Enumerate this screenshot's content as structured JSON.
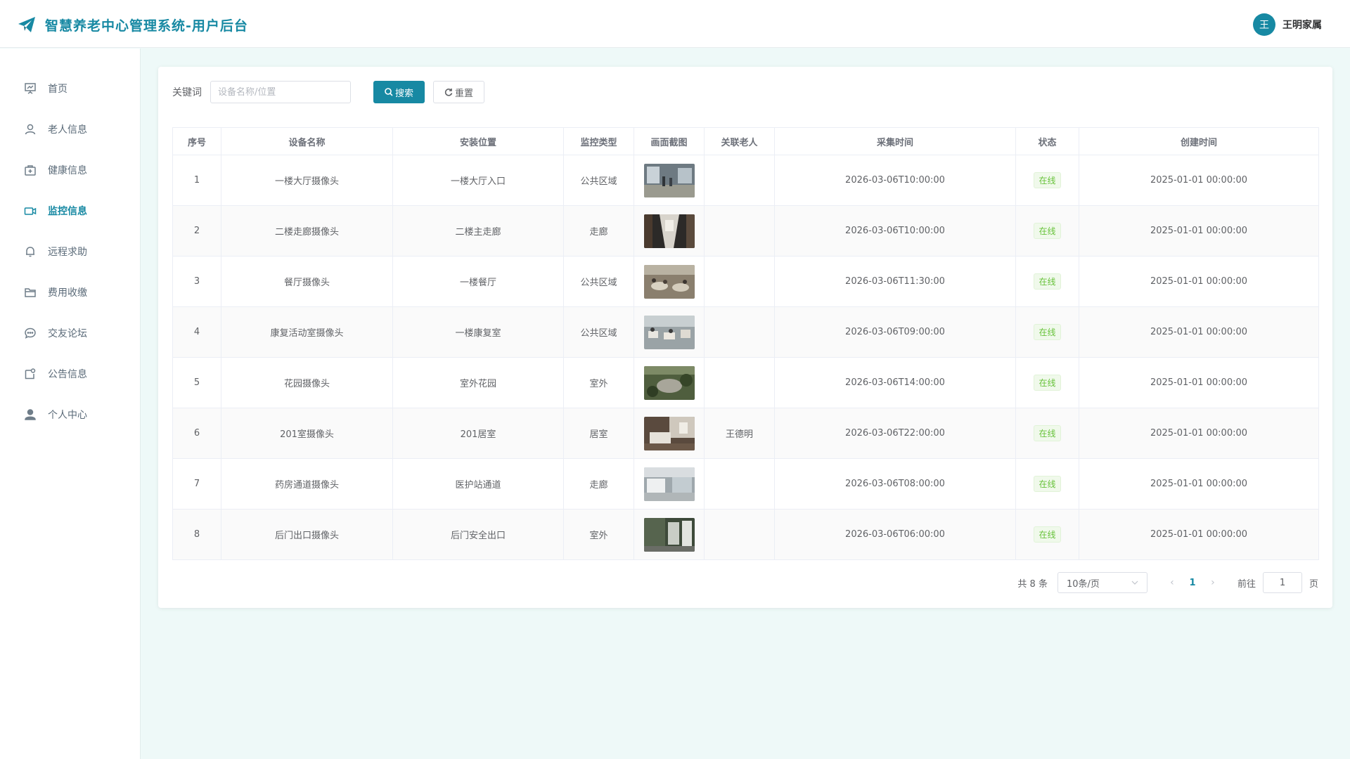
{
  "header": {
    "app_title": "智慧养老中心管理系统-用户后台",
    "user_avatar": "王",
    "user_name": "王明家属",
    "brand_color": "#1789a3"
  },
  "sidebar": {
    "items": [
      {
        "label": "首页",
        "icon": "presentation-icon",
        "active": false
      },
      {
        "label": "老人信息",
        "icon": "user-icon",
        "active": false
      },
      {
        "label": "健康信息",
        "icon": "medical-kit-icon",
        "active": false
      },
      {
        "label": "监控信息",
        "icon": "camera-icon",
        "active": true
      },
      {
        "label": "远程求助",
        "icon": "bell-icon",
        "active": false
      },
      {
        "label": "费用收缴",
        "icon": "folder-icon",
        "active": false
      },
      {
        "label": "交友论坛",
        "icon": "chat-icon",
        "active": false
      },
      {
        "label": "公告信息",
        "icon": "notice-icon",
        "active": false
      },
      {
        "label": "个人中心",
        "icon": "person-icon",
        "active": false
      }
    ]
  },
  "search": {
    "keyword_label": "关键词",
    "placeholder": "设备名称/位置",
    "value": "",
    "search_label": "搜索",
    "reset_label": "重置"
  },
  "table": {
    "columns": [
      "序号",
      "设备名称",
      "安装位置",
      "监控类型",
      "画面截图",
      "关联老人",
      "采集时间",
      "状态",
      "创建时间"
    ],
    "rows": [
      {
        "index": "1",
        "name": "一楼大厅摄像头",
        "location": "一楼大厅入口",
        "type": "公共区域",
        "screenshot": "lobby",
        "elder": "",
        "capture_time": "2026-03-06T10:00:00",
        "status": "在线",
        "created": "2025-01-01 00:00:00"
      },
      {
        "index": "2",
        "name": "二楼走廊摄像头",
        "location": "二楼主走廊",
        "type": "走廊",
        "screenshot": "corridor",
        "elder": "",
        "capture_time": "2026-03-06T10:00:00",
        "status": "在线",
        "created": "2025-01-01 00:00:00"
      },
      {
        "index": "3",
        "name": "餐厅摄像头",
        "location": "一楼餐厅",
        "type": "公共区域",
        "screenshot": "dining",
        "elder": "",
        "capture_time": "2026-03-06T11:30:00",
        "status": "在线",
        "created": "2025-01-01 00:00:00"
      },
      {
        "index": "4",
        "name": "康复活动室摄像头",
        "location": "一楼康复室",
        "type": "公共区域",
        "screenshot": "rehab",
        "elder": "",
        "capture_time": "2026-03-06T09:00:00",
        "status": "在线",
        "created": "2025-01-01 00:00:00"
      },
      {
        "index": "5",
        "name": "花园摄像头",
        "location": "室外花园",
        "type": "室外",
        "screenshot": "garden",
        "elder": "",
        "capture_time": "2026-03-06T14:00:00",
        "status": "在线",
        "created": "2025-01-01 00:00:00"
      },
      {
        "index": "6",
        "name": "201室摄像头",
        "location": "201居室",
        "type": "居室",
        "screenshot": "room",
        "elder": "王德明",
        "capture_time": "2026-03-06T22:00:00",
        "status": "在线",
        "created": "2025-01-01 00:00:00"
      },
      {
        "index": "7",
        "name": "药房通道摄像头",
        "location": "医护站通道",
        "type": "走廊",
        "screenshot": "pharmacy",
        "elder": "",
        "capture_time": "2026-03-06T08:00:00",
        "status": "在线",
        "created": "2025-01-01 00:00:00"
      },
      {
        "index": "8",
        "name": "后门出口摄像头",
        "location": "后门安全出口",
        "type": "室外",
        "screenshot": "backdoor",
        "elder": "",
        "capture_time": "2026-03-06T06:00:00",
        "status": "在线",
        "created": "2025-01-01 00:00:00"
      }
    ],
    "status_color": "#67c23a"
  },
  "pagination": {
    "total_label": "共 8 条",
    "page_size": "10条/页",
    "current_page": "1",
    "goto_label": "前往",
    "goto_value": "1",
    "page_suffix": "页"
  }
}
